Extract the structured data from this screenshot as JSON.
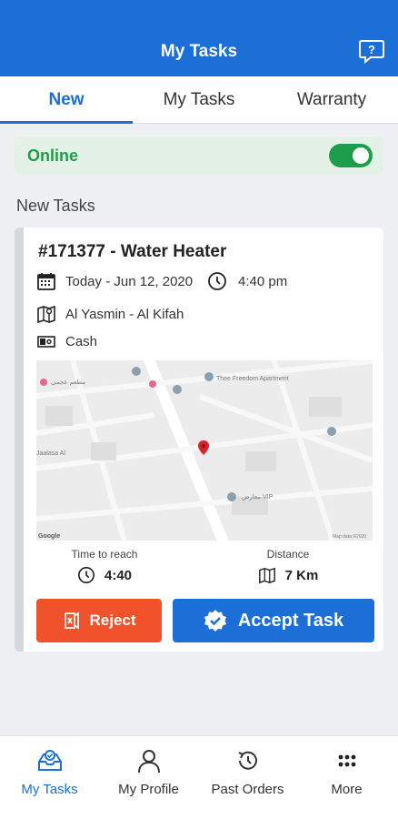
{
  "header": {
    "title": "My Tasks",
    "help_icon": "question-chat-icon"
  },
  "tabs": [
    {
      "label": "New",
      "active": true
    },
    {
      "label": "My Tasks",
      "active": false
    },
    {
      "label": "Warranty",
      "active": false
    }
  ],
  "online": {
    "label": "Online",
    "enabled": true
  },
  "section": {
    "title": "New Tasks"
  },
  "task": {
    "title": "#171377 - Water Heater",
    "date": "Today - Jun 12, 2020",
    "time": "4:40 pm",
    "location": "Al Yasmin - Al Kifah",
    "payment": "Cash",
    "map": {
      "places": [
        "Thee Freedom Apartment",
        "Google",
        "Map data ©2020"
      ]
    },
    "time_to_reach": {
      "caption": "Time to reach",
      "value": "4:40"
    },
    "distance": {
      "caption": "Distance",
      "value": "7 Km"
    },
    "reject_label": "Reject",
    "accept_label": "Accept Task"
  },
  "nav": [
    {
      "label": "My Tasks",
      "icon": "tasks-icon",
      "active": true
    },
    {
      "label": "My Profile",
      "icon": "profile-icon",
      "active": false
    },
    {
      "label": "Past Orders",
      "icon": "history-icon",
      "active": false
    },
    {
      "label": "More",
      "icon": "more-grid-icon",
      "active": false
    }
  ],
  "colors": {
    "primary": "#1b6fd6",
    "online_green": "#1e9e4a",
    "reject_red": "#f0532b"
  }
}
